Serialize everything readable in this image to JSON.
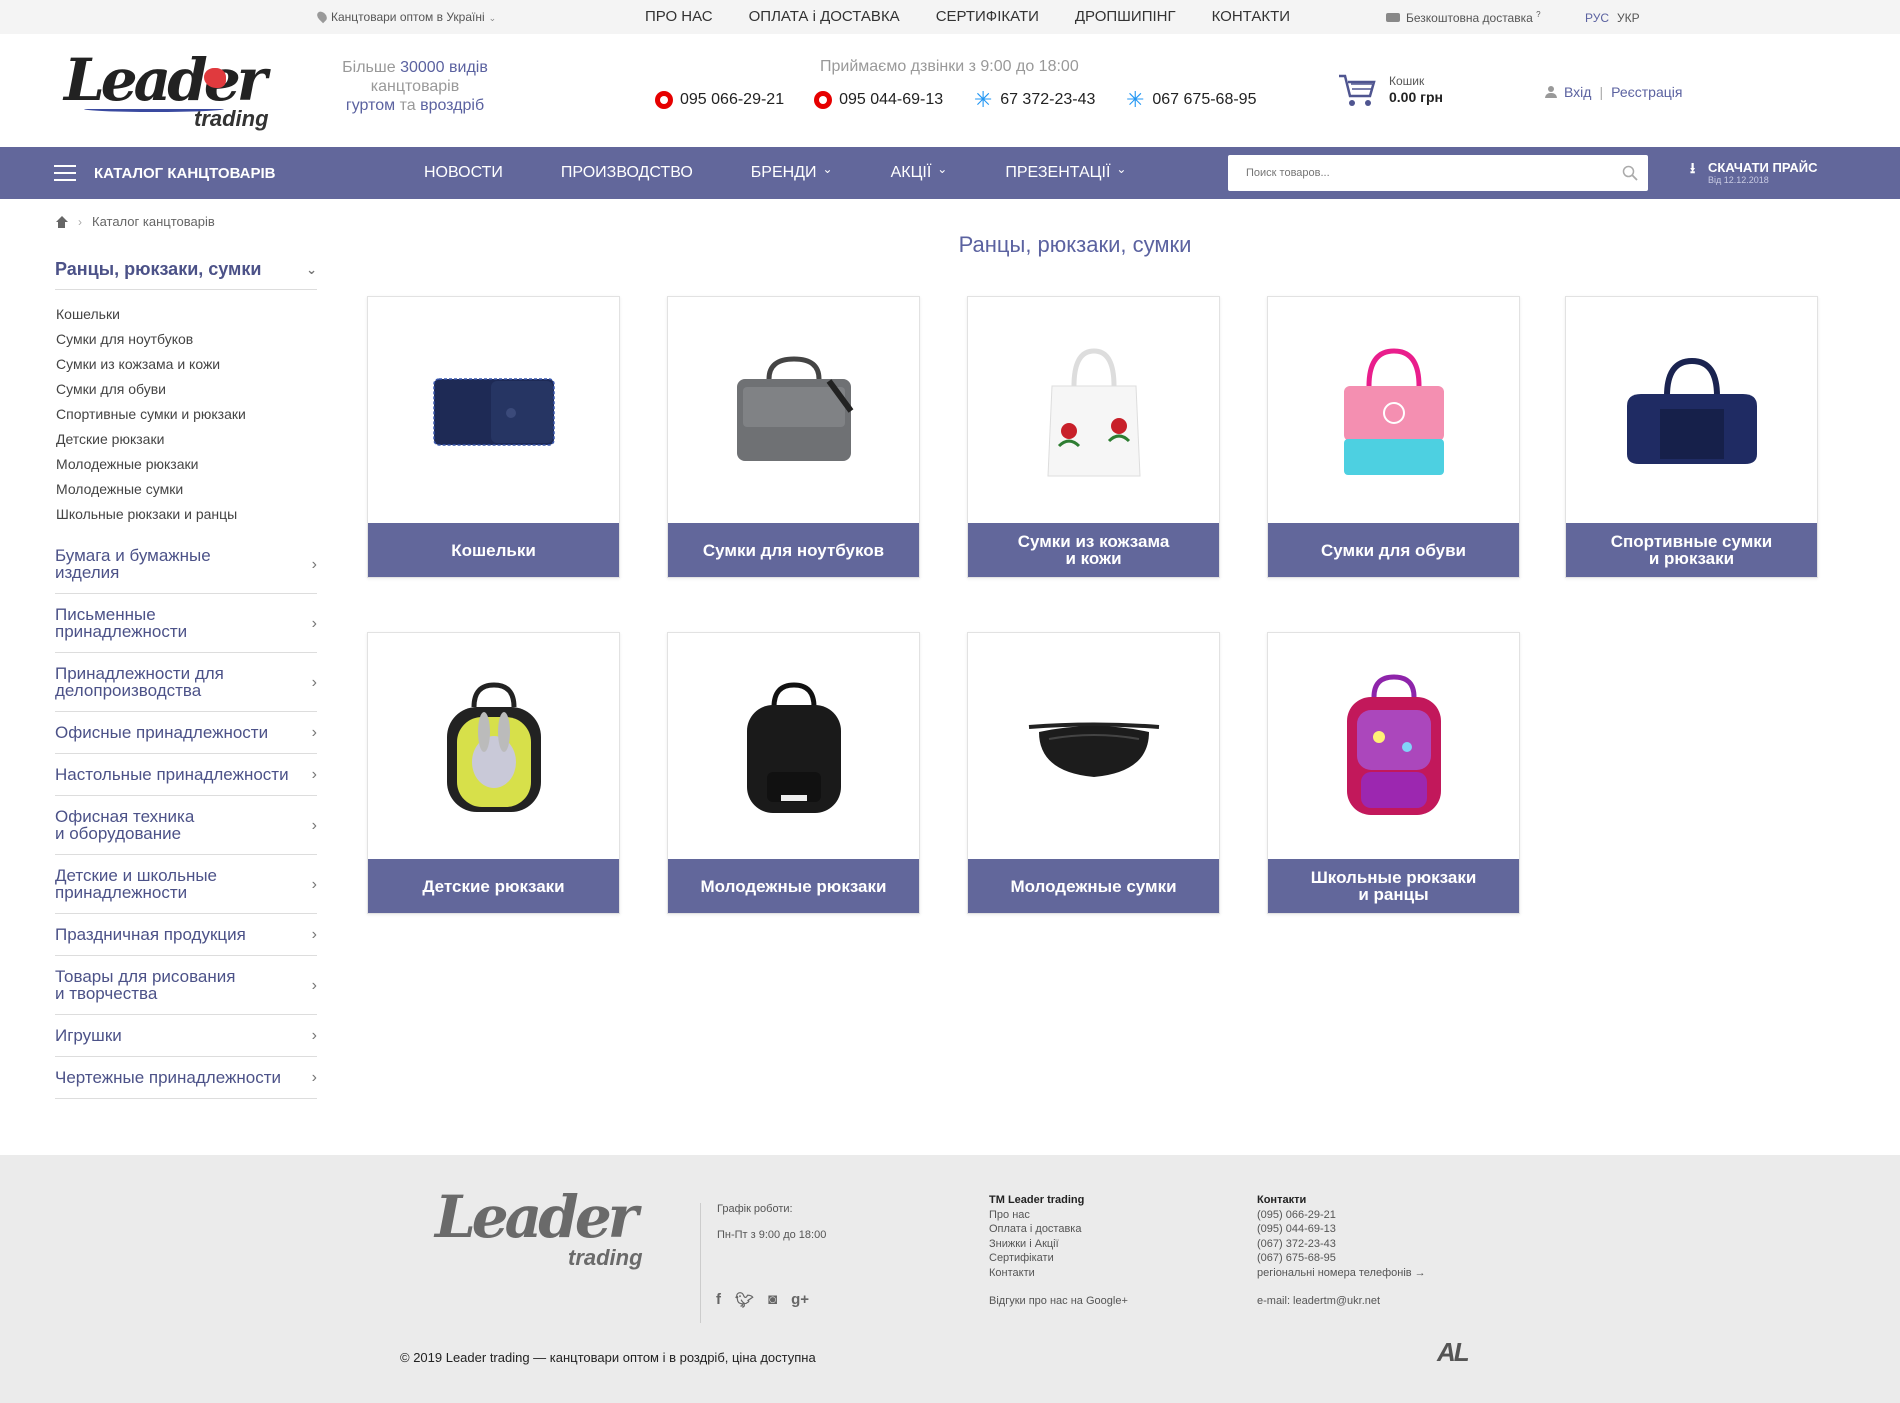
{
  "topbar": {
    "region": "Канцтовари оптом в Україні",
    "nav": [
      "ПРО НАС",
      "ОПЛАТА і ДОСТАВКА",
      "СЕРТИФІКАТИ",
      "ДРОПШИПІНГ",
      "КОНТАКТИ"
    ],
    "delivery": "Безкоштовна доставка",
    "delivery_mark": "?",
    "lang_ru": "РУС",
    "lang_ua": "УКР"
  },
  "header": {
    "logo_main": "Leader",
    "logo_sub": "trading",
    "slogan": {
      "p1": "Більше ",
      "p2": "30000 видів",
      "p3": " канцтоварів",
      "p4": "гуртом",
      "p5": " та ",
      "p6": "вроздріб"
    },
    "call_time": "Приймаємо дзвінки з 9:00 до 18:00",
    "phones": [
      {
        "number": "095 066-29-21",
        "operator": "vodafone-icon"
      },
      {
        "number": "095 044-69-13",
        "operator": "vodafone-icon"
      },
      {
        "number": "67 372-23-43",
        "operator": "kyivstar-icon"
      },
      {
        "number": "067 675-68-95",
        "operator": "kyivstar-icon"
      }
    ],
    "cart_label": "Кошик",
    "cart_sum": "0.00 грн",
    "login": "Вхід",
    "register": "Реєстрація"
  },
  "mainnav": {
    "catalog": "КАТАЛОГ КАНЦТОВАРІВ",
    "links": [
      "НОВОСТИ",
      "ПРОИЗВОДСТВО",
      "БРЕНДИ",
      "АКЦІЇ",
      "ПРЕЗЕНТАЦІЇ"
    ],
    "search_placeholder": "Поиск товаров...",
    "price_title": "СКАЧАТИ ПРАЙС",
    "price_date": "Від 12.12.2018",
    "accent": "#62679b"
  },
  "breadcrumb": {
    "current": "Каталог канцтоварів"
  },
  "sidebar": {
    "active": "Ранцы, рюкзаки, сумки",
    "sub": [
      "Кошельки",
      "Сумки для ноутбуков",
      "Сумки из кожзама и кожи",
      "Сумки для обуви",
      "Спортивные сумки и рюкзаки",
      "Детские рюкзаки",
      "Молодежные рюкзаки",
      "Молодежные сумки",
      "Школьные рюкзаки и ранцы"
    ],
    "categories": [
      {
        "l1": "Бумага и бумажные",
        "l2": "изделия"
      },
      {
        "l1": "Письменные",
        "l2": "принадлежности"
      },
      {
        "l1": "Принадлежности для",
        "l2": "делопроизводства"
      },
      {
        "l1": "Офисные принадлежности",
        "l2": ""
      },
      {
        "l1": "Настольные принадлежности",
        "l2": ""
      },
      {
        "l1": "Офисная техника",
        "l2": "и оборудование"
      },
      {
        "l1": "Детские и школьные",
        "l2": "принадлежности"
      },
      {
        "l1": "Праздничная продукция",
        "l2": ""
      },
      {
        "l1": "Товары для рисования",
        "l2": " и творчества"
      },
      {
        "l1": "Игрушки",
        "l2": ""
      },
      {
        "l1": "Чертежные принадлежности",
        "l2": ""
      }
    ]
  },
  "content": {
    "title": "Ранцы, рюкзаки, сумки",
    "cards": [
      {
        "l1": "Кошельки",
        "l2": ""
      },
      {
        "l1": "Сумки для ноутбуков",
        "l2": ""
      },
      {
        "l1": "Сумки из кожзама",
        "l2": "и кожи"
      },
      {
        "l1": "Сумки для обуви",
        "l2": ""
      },
      {
        "l1": "Спортивные сумки",
        "l2": "и рюкзаки"
      },
      {
        "l1": "Детские рюкзаки",
        "l2": ""
      },
      {
        "l1": "Молодежные рюкзаки",
        "l2": ""
      },
      {
        "l1": "Молодежные сумки",
        "l2": ""
      },
      {
        "l1": "Школьные рюкзаки",
        "l2": "и ранцы"
      }
    ]
  },
  "footer": {
    "logo_main": "Leader",
    "logo_sub": "trading",
    "schedule_title": "Графік роботи:",
    "schedule": "Пн-Пт з 9:00 до 18:00",
    "col1_title": "ТМ Leader trading",
    "col1": [
      "Про нас",
      "Оплата і доставка",
      "Знижки і Акції",
      "Сертифікати",
      "Контакти"
    ],
    "reviews": "Відгуки про нас на Google+",
    "col2_title": "Контакти",
    "col2": [
      "(095) 066-29-21",
      "(095) 044-69-13",
      "(067) 372-23-43",
      "(067) 675-68-95",
      "регіональні номера телефонів →"
    ],
    "email": "e-mail: leadertm@ukr.net",
    "copyright": "© 2019 Leader trading — канцтовари оптом і в роздріб, ціна доступна",
    "dev_logo": "AL"
  }
}
